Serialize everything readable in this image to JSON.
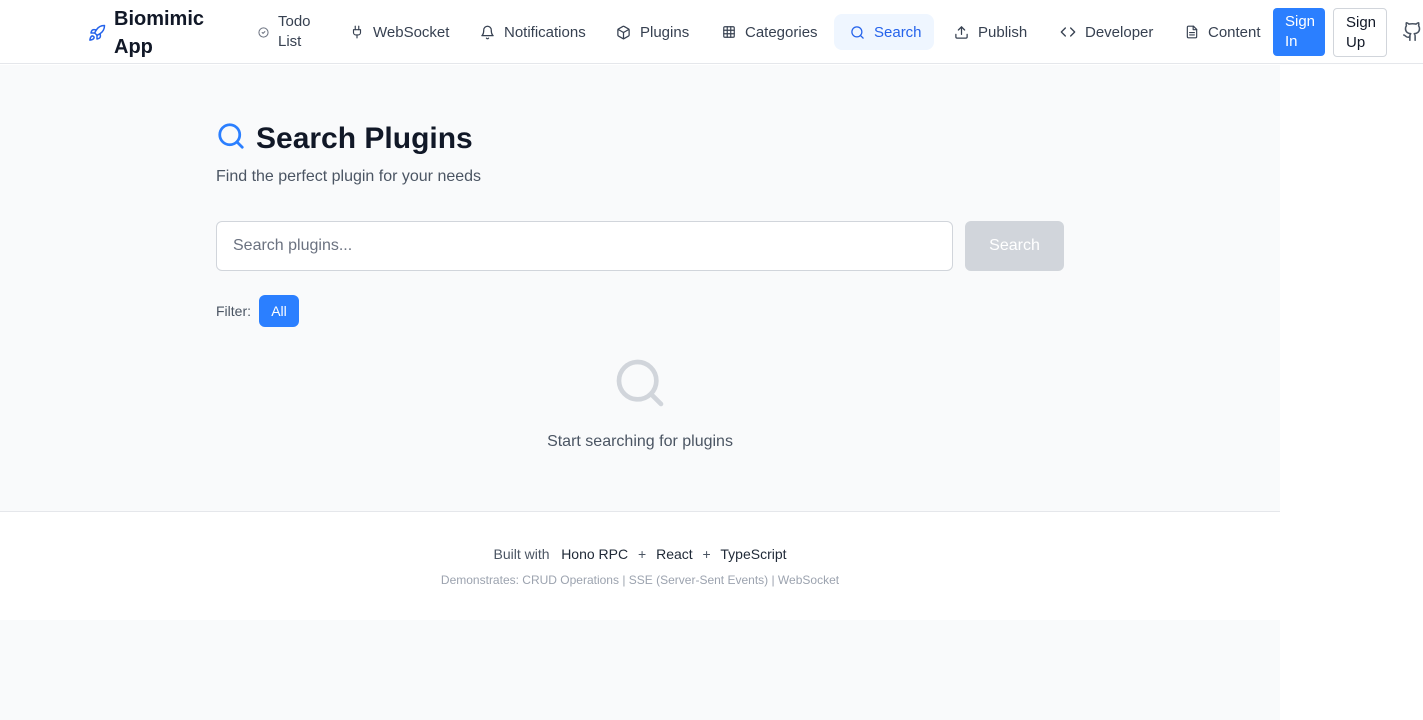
{
  "nav": {
    "brand": "Biomimic App",
    "items": [
      {
        "label": "Todo List",
        "icon": "check-circle-icon"
      },
      {
        "label": "WebSocket",
        "icon": "plug-icon"
      },
      {
        "label": "Notifications",
        "icon": "bell-icon"
      },
      {
        "label": "Plugins",
        "icon": "package-icon"
      },
      {
        "label": "Categories",
        "icon": "grid-icon"
      },
      {
        "label": "Search",
        "icon": "search-icon",
        "active": true
      },
      {
        "label": "Publish",
        "icon": "upload-icon"
      },
      {
        "label": "Developer",
        "icon": "code-icon"
      },
      {
        "label": "Content",
        "icon": "file-icon"
      }
    ],
    "sign_in": "Sign In",
    "sign_up": "Sign Up"
  },
  "page": {
    "title": "Search Plugins",
    "subtitle": "Find the perfect plugin for your needs",
    "search_placeholder": "Search plugins...",
    "search_button": "Search",
    "filter_label": "Filter:",
    "filter_active": "All",
    "empty_text": "Start searching for plugins"
  },
  "footer": {
    "built_with": "Built with",
    "tech": [
      "Hono RPC",
      "React",
      "TypeScript"
    ],
    "plus": "+",
    "demonstrates": "Demonstrates: CRUD Operations | SSE (Server-Sent Events) | WebSocket"
  },
  "colors": {
    "accent": "#2b7fff",
    "active_bg": "#eff6ff",
    "page_bg": "#f9fafb"
  }
}
